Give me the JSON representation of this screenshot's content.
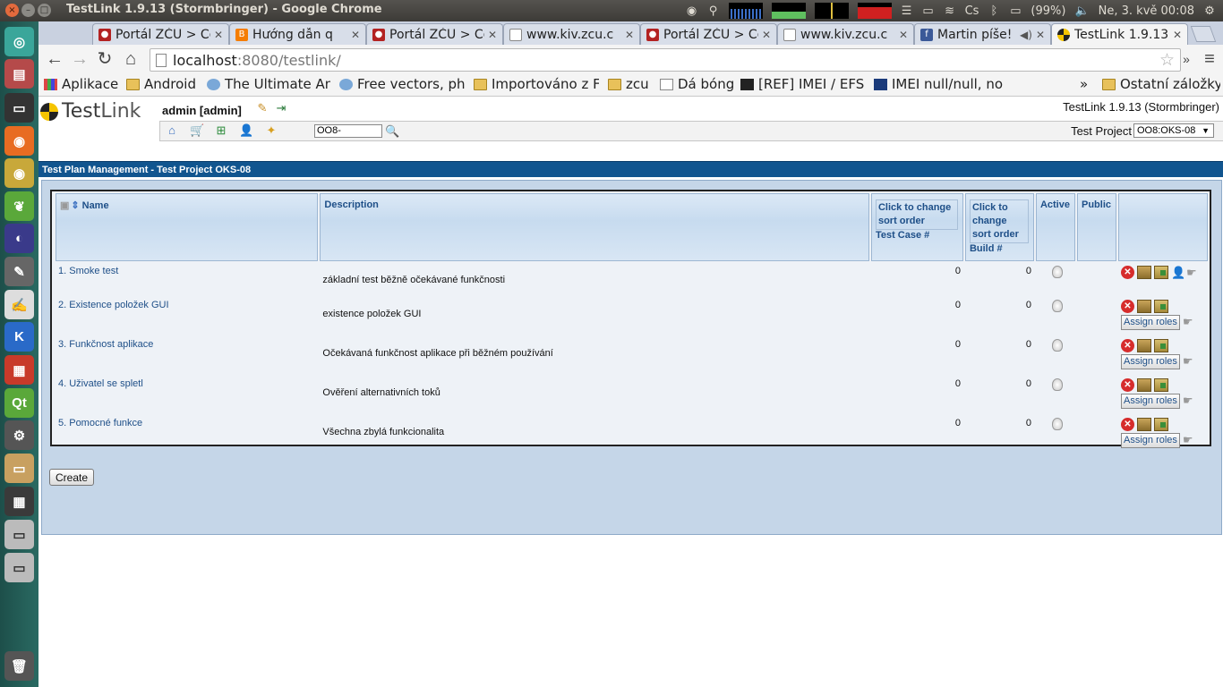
{
  "window": {
    "title": "TestLink 1.9.13 (Stormbringer) - Google Chrome"
  },
  "system_tray": {
    "battery": "(99%)",
    "datetime": "Ne, 3. kvě 00:08"
  },
  "tabs": [
    {
      "label": "Portál ZČU > Co",
      "favicon": "zcu-icon"
    },
    {
      "label": "Hướng dẫn q",
      "favicon": "blogger-icon"
    },
    {
      "label": "Portál ZČU > Co",
      "favicon": "zcu-icon"
    },
    {
      "label": "www.kiv.zcu.c",
      "favicon": "page-icon"
    },
    {
      "label": "Portál ZČU > Co",
      "favicon": "zcu-icon"
    },
    {
      "label": "www.kiv.zcu.c",
      "favicon": "page-icon"
    },
    {
      "label": "Martin píše!",
      "favicon": "facebook-icon"
    },
    {
      "label": "TestLink 1.9.13",
      "favicon": "testlink-icon",
      "active": true
    }
  ],
  "address_bar": {
    "host": "localhost",
    "rest": ":8080/testlink/"
  },
  "bookmarks": [
    {
      "label": "Aplikace",
      "icon": "apps-grid-icon"
    },
    {
      "label": "Android",
      "icon": "folder-icon"
    },
    {
      "label": "The Ultimate And",
      "icon": "site-icon"
    },
    {
      "label": "Free vectors, pho",
      "icon": "site-icon"
    },
    {
      "label": "Importováno z Fi",
      "icon": "folder-icon"
    },
    {
      "label": "zcu",
      "icon": "folder-icon"
    },
    {
      "label": "Dá bóng",
      "icon": "page-icon"
    },
    {
      "label": "[REF] IMEI / EFS -",
      "icon": "xda-icon"
    },
    {
      "label": "IMEI null/null, no",
      "icon": "sam-icon"
    }
  ],
  "bookmarks_overflow": "»",
  "other_bookmarks": "Ostatní záložky",
  "testlink": {
    "logo_text_a": "Test",
    "logo_text_b": "Link",
    "user": "admin [admin]",
    "version": "TestLink 1.9.13 (Stormbringer)",
    "search_value": "OO8-",
    "project_label": "Test Project",
    "project_selected": "OO8:OKS-08",
    "page_title": "Test Plan Management - Test Project OKS-08",
    "columns": {
      "name": "Name",
      "description": "Description",
      "tc_sort": "Click to change sort order",
      "tc_label": "Test Case #",
      "build_sort": "Click to change sort order",
      "build_label": "Build #",
      "active": "Active",
      "public": "Public"
    },
    "plans": [
      {
        "name": "1. Smoke test",
        "description": "základní test běžně očekávané funkčnosti",
        "test_cases": "0",
        "builds": "0"
      },
      {
        "name": "2. Existence položek GUI",
        "description": "existence položek GUI",
        "test_cases": "0",
        "builds": "0"
      },
      {
        "name": "3. Funkčnost aplikace",
        "description": "Očekávaná funkčnost aplikace při běžném používání",
        "test_cases": "0",
        "builds": "0"
      },
      {
        "name": "4. Uživatel se spletl",
        "description": "Ověření alternativních toků",
        "test_cases": "0",
        "builds": "0"
      },
      {
        "name": "5. Pomocné funkce",
        "description": "Všechna zbylá funkcionalita",
        "test_cases": "0",
        "builds": "0"
      }
    ],
    "assign_roles": "Assign roles",
    "create_button": "Create"
  },
  "colors": {
    "title_bar": "#11558f",
    "work_area": "#c5d6e8",
    "header_text": "#1e4f88"
  }
}
